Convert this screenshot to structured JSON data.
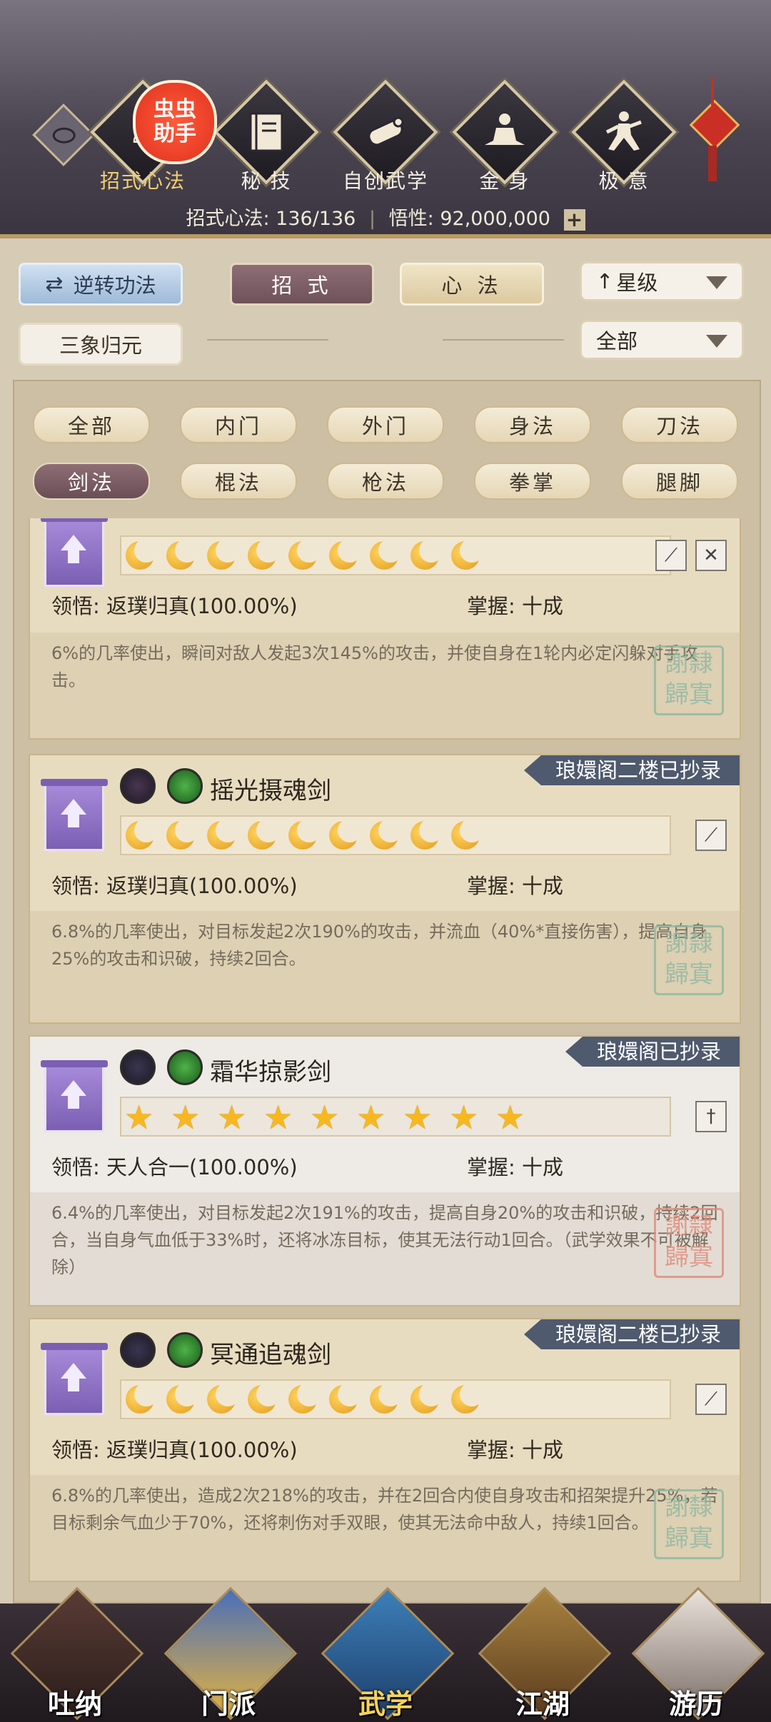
{
  "header": {
    "tabs": [
      {
        "label": "招式心法",
        "icon": "monk-icon",
        "active": true
      },
      {
        "label": "秘 技",
        "icon": "book-icon",
        "active": false
      },
      {
        "label": "自创武学",
        "icon": "scroll-icon",
        "active": false
      },
      {
        "label": "金 身",
        "icon": "meditation-icon",
        "active": false
      },
      {
        "label": "极 意",
        "icon": "martial-stance-icon",
        "active": false
      }
    ],
    "badge": "虫虫助手",
    "stats": {
      "moves_label": "招式心法:",
      "moves_value": "136/136",
      "insight_label": "悟性:",
      "insight_value": "92,000,000",
      "plus": "+"
    }
  },
  "controls": {
    "reverse_label": "逆转功法",
    "moves_tab": "招 式",
    "mind_tab": "心 法",
    "sanxiang_label": "三象归元",
    "sort_label": "星级",
    "sort_arrow": "↑",
    "filter_label": "全部"
  },
  "filters": [
    "全部",
    "内门",
    "外门",
    "身法",
    "刀法",
    "剑法",
    "棍法",
    "枪法",
    "拳掌",
    "腿脚"
  ],
  "selected_filter": "剑法",
  "cards": [
    {
      "name": "",
      "level_type": "moon",
      "level_count": 9,
      "comprehension_label": "领悟:",
      "comprehension": "返璞归真(100.00%)",
      "mastery_label": "掌握:",
      "mastery": "十成",
      "description": "6%的几率使出，瞬间对敌人发起3次145%的攻击，并使自身在1轮内必定闪躲对手攻击。",
      "tag": "",
      "seal": "謝隸歸寘"
    },
    {
      "name": "摇光摄魂剑",
      "level_type": "moon",
      "level_count": 9,
      "comprehension_label": "领悟:",
      "comprehension": "返璞归真(100.00%)",
      "mastery_label": "掌握:",
      "mastery": "十成",
      "description": "6.8%的几率使出，对目标发起2次190%的攻击，并流血（40%*直接伤害），提高自身25%的攻击和识破，持续2回合。",
      "tag": "琅嬛阁二楼已抄录",
      "seal": "謝隸歸寘"
    },
    {
      "name": "霜华掠影剑",
      "level_type": "star",
      "level_count": 9,
      "comprehension_label": "领悟:",
      "comprehension": "天人合一(100.00%)",
      "mastery_label": "掌握:",
      "mastery": "十成",
      "description": "6.4%的几率使出，对目标发起2次191%的攻击，提高自身20%的攻击和识破，持续2回合，当自身气血低于33%时，还将冰冻目标，使其无法行动1回合。（武学效果不可被解除）",
      "tag": "琅嬛阁已抄录",
      "seal": "謝隸歸寘"
    },
    {
      "name": "冥通追魂剑",
      "level_type": "moon",
      "level_count": 9,
      "comprehension_label": "领悟:",
      "comprehension": "返璞归真(100.00%)",
      "mastery_label": "掌握:",
      "mastery": "十成",
      "description": "6.8%的几率使出，造成2次218%的攻击，并在2回合内使自身攻击和招架提升25%，若目标剩余气血少于70%，还将刺伤对手双眼，使其无法命中敌人，持续1回合。",
      "tag": "琅嬛阁二楼已抄录",
      "seal": "謝隸歸寘"
    }
  ],
  "bottom_nav": [
    {
      "label": "吐纳",
      "icon": "monk-portrait-icon",
      "active": false
    },
    {
      "label": "门派",
      "icon": "sect-flag-icon",
      "active": false
    },
    {
      "label": "武学",
      "icon": "manual-books-icon",
      "active": true
    },
    {
      "label": "江湖",
      "icon": "straw-hat-icon",
      "active": false
    },
    {
      "label": "游历",
      "icon": "horse-icon",
      "active": false
    }
  ]
}
